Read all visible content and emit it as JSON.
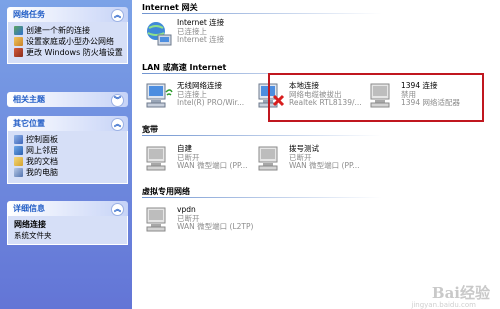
{
  "left_panel": {
    "network_tasks": {
      "title": "网络任务",
      "items": [
        {
          "label": "创建一个新的连接",
          "icon": "new-connection-icon"
        },
        {
          "label": "设置家庭或小型办公网络",
          "icon": "home-network-icon"
        },
        {
          "label": "更改 Windows 防火墙设置",
          "icon": "firewall-icon"
        }
      ]
    },
    "related_topics": {
      "title": "相关主题"
    },
    "other_places": {
      "title": "其它位置",
      "items": [
        {
          "label": "控制面板",
          "icon": "control-panel-icon"
        },
        {
          "label": "网上邻居",
          "icon": "network-places-icon"
        },
        {
          "label": "我的文档",
          "icon": "my-documents-icon"
        },
        {
          "label": "我的电脑",
          "icon": "my-computer-icon"
        }
      ]
    },
    "details": {
      "title": "详细信息",
      "name": "网络连接",
      "type": "系统文件夹"
    }
  },
  "groups": {
    "internet_gateway": {
      "title": "Internet 网关",
      "items": [
        {
          "name": "Internet 连接",
          "status": "已连接上",
          "device": "Internet 连接"
        }
      ]
    },
    "lan": {
      "title": "LAN 或高速 Internet",
      "items": [
        {
          "name": "无线网络连接",
          "status": "已连接上",
          "device": "Intel(R) PRO/Wir..."
        },
        {
          "name": "本地连接",
          "status": "网络电缆被拔出",
          "device": "Realtek RTL8139/..."
        },
        {
          "name": "1394 连接",
          "status": "禁用",
          "device": "1394 网络适配器"
        }
      ]
    },
    "broadband": {
      "title": "宽带",
      "items": [
        {
          "name": "自建",
          "status": "已断开",
          "device": "WAN 微型端口 (PP..."
        },
        {
          "name": "拨号测试",
          "status": "已断开",
          "device": "WAN 微型端口 (PP..."
        }
      ]
    },
    "vpn": {
      "title": "虚拟专用网络",
      "items": [
        {
          "name": "vpdn",
          "status": "已断开",
          "device": "WAN 微型端口 (L2TP)"
        }
      ]
    }
  },
  "watermark": {
    "text": "Bai经验",
    "sub": "jingyan.baidu.com"
  },
  "colors": {
    "highlight": "#c0171f",
    "panel_header": "#215dc6",
    "pane_bg": "#6375d6"
  }
}
